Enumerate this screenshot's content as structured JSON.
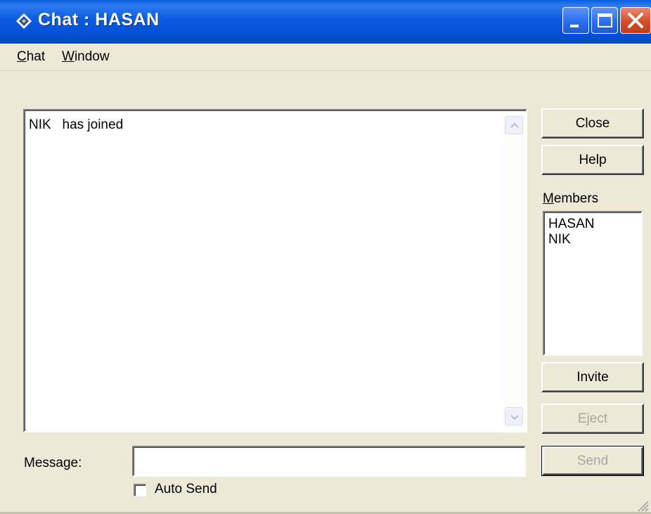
{
  "window": {
    "title": "Chat : HASAN"
  },
  "menu": [
    {
      "mnemonic": "C",
      "rest": "hat"
    },
    {
      "mnemonic": "W",
      "rest": "indow"
    }
  ],
  "transcript": {
    "lines": [
      "NIK   has joined"
    ]
  },
  "buttons": {
    "close": "Close",
    "help": "Help",
    "invite": "Invite",
    "eject": "Eject",
    "send": "Send"
  },
  "members": {
    "label_mnemonic": "M",
    "label_rest": "embers",
    "items": [
      "HASAN",
      "NIK"
    ]
  },
  "message": {
    "label": "Message:",
    "value": ""
  },
  "auto_send": {
    "label": "Auto Send",
    "checked": false
  },
  "colors": {
    "titlebar": "#0552d6",
    "face": "#ece9d8",
    "close_button": "#d4502c"
  }
}
